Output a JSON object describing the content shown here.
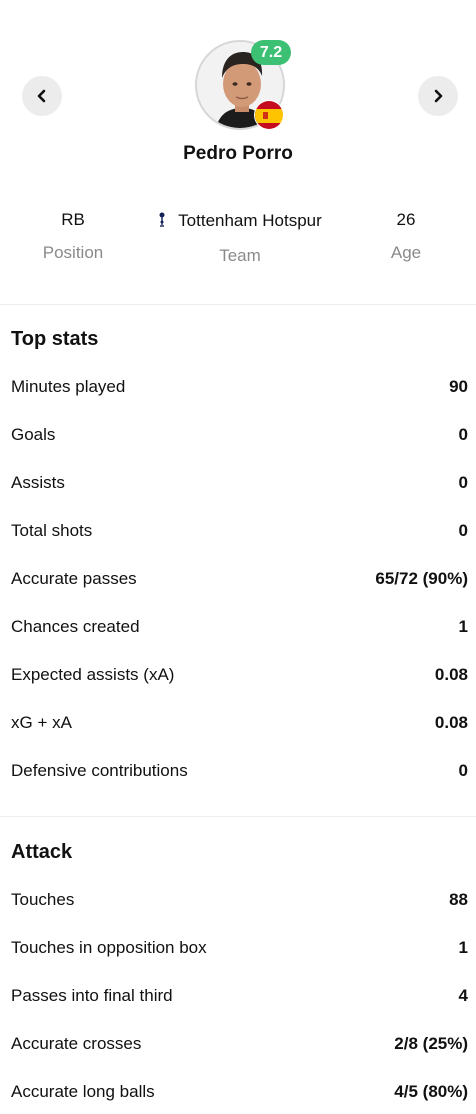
{
  "player": {
    "name": "Pedro Porro",
    "rating": "7.2",
    "position": "RB",
    "position_label": "Position",
    "team": "Tottenham Hotspur",
    "team_label": "Team",
    "age": "26",
    "age_label": "Age"
  },
  "icons": {
    "prev": "chevron-left-icon",
    "next": "chevron-right-icon",
    "flag": "spain-flag-icon",
    "team": "tottenham-crest-icon"
  },
  "colors": {
    "rating_badge": "#3cc174",
    "nav_button": "#ececec",
    "label_gray": "#8a8a8a"
  },
  "top_stats": {
    "title": "Top stats",
    "rows": [
      {
        "label": "Minutes played",
        "value": "90"
      },
      {
        "label": "Goals",
        "value": "0"
      },
      {
        "label": "Assists",
        "value": "0"
      },
      {
        "label": "Total shots",
        "value": "0"
      },
      {
        "label": "Accurate passes",
        "value": "65/72 (90%)"
      },
      {
        "label": "Chances created",
        "value": "1"
      },
      {
        "label": "Expected assists (xA)",
        "value": "0.08"
      },
      {
        "label": "xG + xA",
        "value": "0.08"
      },
      {
        "label": "Defensive contributions",
        "value": "0"
      }
    ]
  },
  "attack": {
    "title": "Attack",
    "rows": [
      {
        "label": "Touches",
        "value": "88"
      },
      {
        "label": "Touches in opposition box",
        "value": "1"
      },
      {
        "label": "Passes into final third",
        "value": "4"
      },
      {
        "label": "Accurate crosses",
        "value": "2/8 (25%)"
      },
      {
        "label": "Accurate long balls",
        "value": "4/5 (80%)"
      }
    ]
  }
}
